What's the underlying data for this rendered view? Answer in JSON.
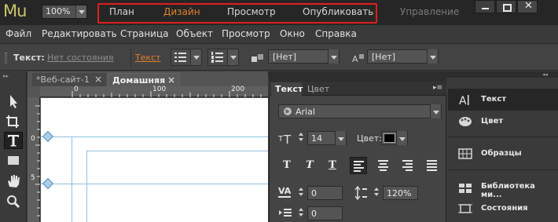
{
  "app": {
    "logo": "Mu",
    "zoom": "100%"
  },
  "workspaces": {
    "plan": "План",
    "design": "Дизайн",
    "preview": "Просмотр",
    "publish": "Опубликовать",
    "manage": "Управление"
  },
  "menu": [
    "Файл",
    "Редактировать",
    "Страница",
    "Объект",
    "Просмотр",
    "Окно",
    "Справка"
  ],
  "propbar": {
    "label": "Текст:",
    "state": "Нет состояния",
    "text_link": "Текст",
    "select1": "[Нет]",
    "select2": "[Нет]"
  },
  "tabs": [
    {
      "label": "*Веб-сайт-1",
      "close": "×"
    },
    {
      "label": "Домашняя",
      "close": "×"
    }
  ],
  "rulers": {
    "h0": "0",
    "h1": "100",
    "h2": "200",
    "v0": "0",
    "v1": "5"
  },
  "text_panel": {
    "tab_text": "Текст",
    "tab_color": "Цвет",
    "menu": "▸≡",
    "font": "Arial",
    "size": "14",
    "color_label": "Цвет:",
    "tracking_icon": "VA",
    "tracking": "0",
    "leading": "120%",
    "indent": "0",
    "style_buttons": [
      "T",
      "T",
      "T"
    ]
  },
  "right_panel": [
    "Текст",
    "Цвет",
    "Образцы",
    "Библиотека ми...",
    "Состояния"
  ],
  "colors": {
    "accent": "#e0812a",
    "highlight_box": "#e01f1f",
    "text_color_swatch": "#000000"
  }
}
